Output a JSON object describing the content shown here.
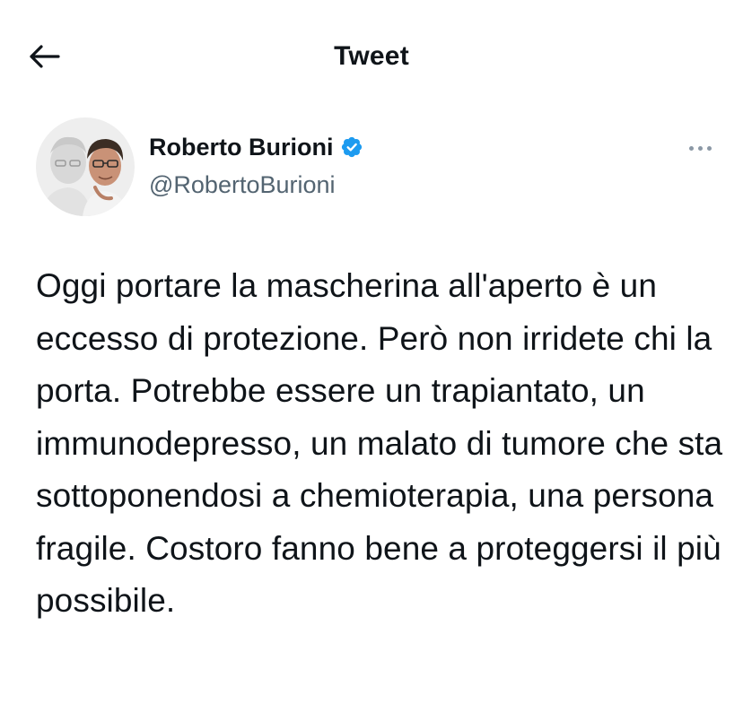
{
  "header": {
    "title": "Tweet",
    "back_icon": "arrow-left-icon"
  },
  "author": {
    "display_name": "Roberto Burioni",
    "handle": "@RobertoBurioni",
    "verified": true,
    "verified_icon": "verified-badge-icon",
    "more_icon": "more-horizontal-icon",
    "avatar": "avatar-photo"
  },
  "tweet": {
    "text": "Oggi portare la mascherina all'aperto è un eccesso di protezione. Però non irridete chi la porta. Potrebbe essere un trapiantato, un immunodepresso, un malato di tumore che sta sottoponendosi a chemioterapia, una persona fragile. Costoro fanno bene a proteggersi il più possibile."
  },
  "colors": {
    "text": "#0f1419",
    "secondary": "#536471",
    "verified": "#1d9bf0",
    "background": "#ffffff"
  }
}
